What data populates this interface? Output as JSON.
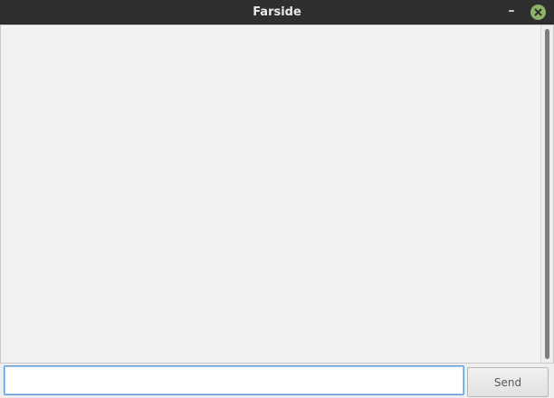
{
  "window": {
    "title": "Farside",
    "minimize_symbol": "–",
    "icons": {
      "minimize": "minimize-icon",
      "close": "close-icon"
    },
    "colors": {
      "titlebar": "#2f2f2f",
      "close_button": "#8fb26b",
      "input_focus": "#5b9bd6"
    }
  },
  "chat": {
    "messages": []
  },
  "composer": {
    "input_value": "",
    "send_label": "Send"
  }
}
